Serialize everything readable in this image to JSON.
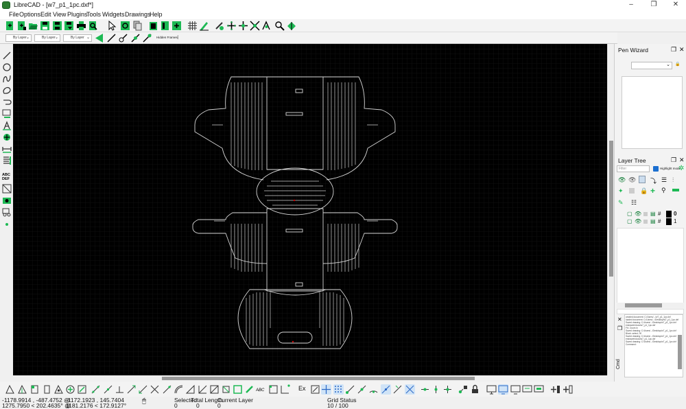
{
  "window": {
    "title": "LibreCAD - [w7_p1_1pc.dxf*]",
    "minimize": "–",
    "maximize": "❐",
    "close": "✕"
  },
  "menu": [
    "File",
    "Options",
    "Edit",
    "View",
    "Plugins",
    "Tools",
    "Widgets",
    "Drawings",
    "Help"
  ],
  "pen_toolbar": {
    "color": "By Layer",
    "width": "By Layer",
    "linetype": "By Layer",
    "hidden_frame": "Hidden Frames"
  },
  "pen_wizard": {
    "title": "Pen Wizard",
    "combo_value": ""
  },
  "layer_tree": {
    "title": "Layer Tree",
    "filter_placeholder": "Filter",
    "highlight_label": "Highlight mode",
    "layers": [
      {
        "name": "0"
      },
      {
        "name": "1"
      }
    ]
  },
  "command": {
    "label": "Cmd",
    "log": [
      "created document: C:/Users/.../w7_p1_1pc.dxf",
      "loaded document: C:/Users/.../Desktop/w7_p1_1pc.dxf",
      "Saved drawing: C:/Users/.../Desktop/w7_p1_1pc.dxf",
      "endrawer/docs/w7_p1_1pc.dxf",
      "Fit / Zoom in",
      "Saved drawing: C:/Users/.../Desktop/w7_p1_1pc.dxf",
      "Block: select, 00",
      "Saved drawing: C:/Users/.../Desktop/w7_p1_1pc.dxf",
      "endrawer/docs/w7_p1_1pc.dxf",
      "Saved drawing: C:/Users/.../Desktop/w7_p1_1pc.dxf",
      "Command:"
    ]
  },
  "status": {
    "coord_abs": "-1178.9914 , -487.4752 @",
    "coord_rel": "-1172.1923 , 145.7404",
    "polar_abs": "1275.7950 < 202.4635° @",
    "polar_rel": "1181.2176 < 172.9127°",
    "selected_label": "Selected",
    "selected_value": "0",
    "total_length_label": "Total Length",
    "total_length_value": "0",
    "current_layer_label": "Current Layer",
    "current_layer_value": "0",
    "grid_status_label": "Grid Status",
    "grid_status_value": "10 / 100"
  },
  "bottom_toolbar": {
    "ex_label": "Ex"
  },
  "colors": {
    "accent": "#1db954",
    "canvas": "#000000",
    "lines": "#d8d8d8",
    "marker": "#d00000"
  }
}
